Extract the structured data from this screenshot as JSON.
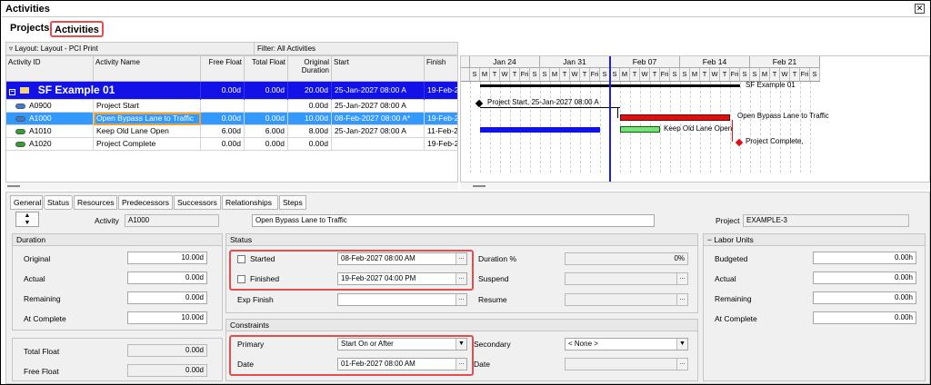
{
  "window": {
    "title": "Activities"
  },
  "module_tabs": {
    "projects": "Projects",
    "activities": "Activities"
  },
  "toolbar": {
    "layout": "Layout: Layout - PCI Print",
    "filter": "Filter: All Activities"
  },
  "columns": {
    "id": "Activity ID",
    "name": "Activity Name",
    "free_float": "Free Float",
    "total_float": "Total Float",
    "orig_dur": "Original Duration",
    "start": "Start",
    "finish": "Finish"
  },
  "group_row": {
    "name": "SF Example 01",
    "free_float": "0.00d",
    "total_float": "0.00d",
    "orig_dur": "20.00d",
    "start": "25-Jan-2027 08:00 A",
    "finish": "19-Feb-2"
  },
  "rows": [
    {
      "id": "A0900",
      "name": "Project Start",
      "free_float": "",
      "total_float": "",
      "orig_dur": "0.00d",
      "start": "25-Jan-2027 08:00 A",
      "finish": "",
      "icon_color": "#3a7ad9"
    },
    {
      "id": "A1000",
      "name": "Open Bypass Lane to Traffic",
      "free_float": "0.00d",
      "total_float": "0.00d",
      "orig_dur": "10.00d",
      "start": "08-Feb-2027 08:00 A*",
      "finish": "19-Feb-2",
      "icon_color": "#3a7ad9"
    },
    {
      "id": "A1010",
      "name": "Keep Old Lane Open",
      "free_float": "6.00d",
      "total_float": "6.00d",
      "orig_dur": "8.00d",
      "start": "25-Jan-2027 08:00 A",
      "finish": "11-Feb-2",
      "icon_color": "#2aa52a"
    },
    {
      "id": "A1020",
      "name": "Project Complete",
      "free_float": "0.00d",
      "total_float": "0.00d",
      "orig_dur": "0.00d",
      "start": "",
      "finish": "19-Feb-2",
      "icon_color": "#2aa52a"
    }
  ],
  "gantt": {
    "weeks": [
      "Jan 24",
      "Jan 31",
      "Feb 07",
      "Feb 14",
      "Feb 21"
    ],
    "days": [
      "S",
      "M",
      "T",
      "W",
      "T",
      "Fri",
      "S"
    ],
    "labels": {
      "summary": "SF Example 01",
      "start": "Project Start, 25-Jan-2027 08:00 A",
      "bypass": "Open Bypass Lane to Traffic",
      "keep": "Keep Old Lane Open",
      "complete": "Project Complete,"
    },
    "colors": {
      "critical": "#e01010",
      "blue": "#1212e8",
      "green": "#7be07b",
      "timeline": "#2020d0"
    }
  },
  "detail_tabs": [
    "General",
    "Status",
    "Resources",
    "Predecessors",
    "Successors",
    "Relationships",
    "Steps"
  ],
  "activity": {
    "label": "Activity",
    "id": "A1000",
    "name": "Open Bypass Lane to Traffic",
    "project_label": "Project",
    "project": "EXAMPLE-3"
  },
  "duration": {
    "title": "Duration",
    "original_label": "Original",
    "original": "10.00d",
    "actual_label": "Actual",
    "actual": "0.00d",
    "remaining_label": "Remaining",
    "remaining": "0.00d",
    "at_complete_label": "At Complete",
    "at_complete": "10.00d"
  },
  "floats": {
    "total_label": "Total Float",
    "total": "0.00d",
    "free_label": "Free Float",
    "free": "0.00d"
  },
  "status": {
    "title": "Status",
    "started_label": "Started",
    "started": "08-Feb-2027 08:00 AM",
    "finished_label": "Finished",
    "finished": "19-Feb-2027 04:00 PM",
    "exp_finish_label": "Exp Finish",
    "duration_pct_label": "Duration %",
    "duration_pct": "0%",
    "suspend_label": "Suspend",
    "resume_label": "Resume"
  },
  "constraints": {
    "title": "Constraints",
    "primary_label": "Primary",
    "primary": "Start On or After",
    "date_label": "Date",
    "date": "01-Feb-2027 08:00 AM",
    "secondary_label": "Secondary",
    "secondary": "< None >",
    "date2_label": "Date"
  },
  "labor": {
    "title": "Labor Units",
    "budgeted_label": "Budgeted",
    "budgeted": "0.00h",
    "actual_label": "Actual",
    "actual": "0.00h",
    "remaining_label": "Remaining",
    "remaining": "0.00h",
    "at_complete_label": "At Complete",
    "at_complete": "0.00h"
  }
}
